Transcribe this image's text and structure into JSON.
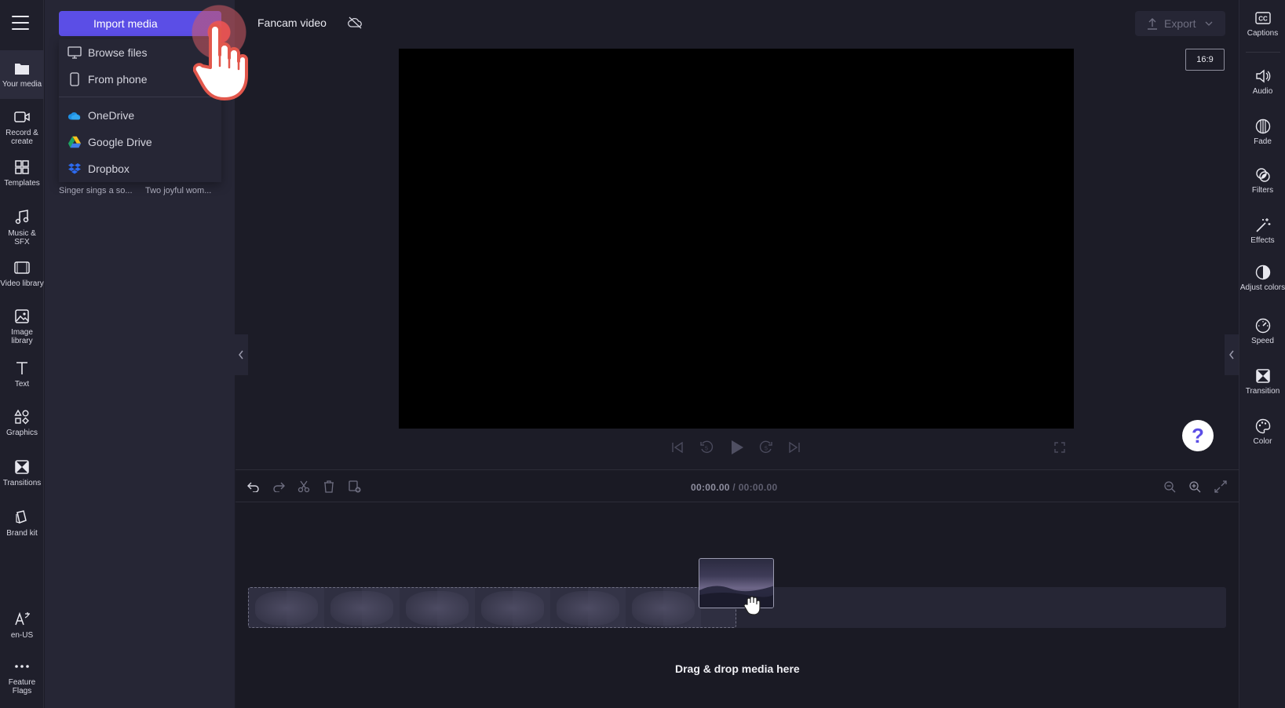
{
  "left_rail": {
    "items": [
      {
        "label": "Your media",
        "icon": "folder-icon"
      },
      {
        "label": "Record & create",
        "icon": "video-camera-icon"
      },
      {
        "label": "Templates",
        "icon": "templates-icon"
      },
      {
        "label": "Music & SFX",
        "icon": "music-note-icon"
      },
      {
        "label": "Video library",
        "icon": "film-icon"
      },
      {
        "label": "Image library",
        "icon": "image-icon"
      },
      {
        "label": "Text",
        "icon": "text-icon"
      },
      {
        "label": "Graphics",
        "icon": "shapes-icon"
      },
      {
        "label": "Transitions",
        "icon": "transition-icon"
      },
      {
        "label": "Brand kit",
        "icon": "brand-kit-icon"
      }
    ],
    "language": "en-US",
    "feature_flags": "Feature Flags"
  },
  "media_panel": {
    "import_label": "Import media",
    "dropdown": {
      "browse": "Browse files",
      "phone": "From phone",
      "onedrive": "OneDrive",
      "gdrive": "Google Drive",
      "dropbox": "Dropbox"
    },
    "captions": [
      "Singer sings a so...",
      "Two joyful wom..."
    ]
  },
  "topbar": {
    "project_title": "Fancam video",
    "export_label": "Export",
    "aspect_ratio": "16:9"
  },
  "timeline": {
    "time_current": "00:00.00",
    "time_separator": " / ",
    "time_total": "00:00.00",
    "drop_text": "Drag & drop media here"
  },
  "help": {
    "label": "?"
  },
  "right_rail": {
    "items": [
      {
        "label": "Captions",
        "icon": "captions-icon"
      },
      {
        "label": "Audio",
        "icon": "speaker-icon"
      },
      {
        "label": "Fade",
        "icon": "fade-icon"
      },
      {
        "label": "Filters",
        "icon": "filters-icon"
      },
      {
        "label": "Effects",
        "icon": "magic-wand-icon"
      },
      {
        "label": "Adjust colors",
        "icon": "contrast-icon"
      },
      {
        "label": "Speed",
        "icon": "speedometer-icon"
      },
      {
        "label": "Transition",
        "icon": "transition-icon"
      },
      {
        "label": "Color",
        "icon": "palette-icon"
      }
    ]
  },
  "colors": {
    "accent": "#5b4ee6",
    "background": "#1c1c27",
    "panel": "#262635",
    "rail": "#1f1f2b"
  }
}
